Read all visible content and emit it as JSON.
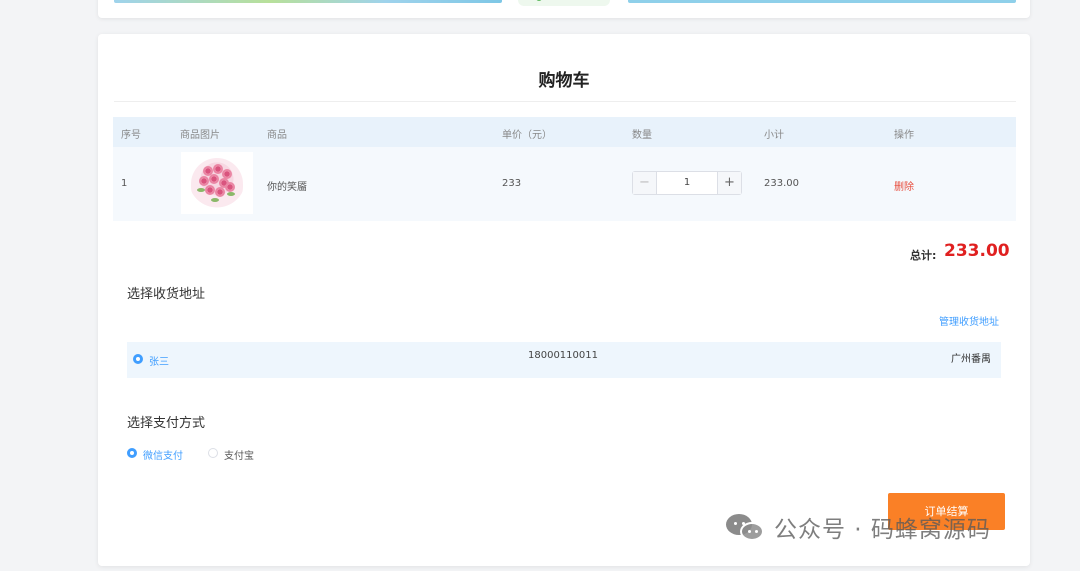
{
  "cart": {
    "title": "购物车",
    "headers": {
      "index": "序号",
      "image": "商品图片",
      "product": "商品",
      "unit_price": "单价（元）",
      "quantity": "数量",
      "subtotal": "小计",
      "action": "操作"
    },
    "items": [
      {
        "index": "1",
        "name": "你的笑靥",
        "unit_price": "233",
        "quantity": "1",
        "subtotal": "233.00",
        "delete_label": "删除"
      }
    ],
    "stepper": {
      "minus": "−",
      "plus": "+"
    },
    "total_label": "总计:",
    "total_value": "233.00"
  },
  "address": {
    "title": "选择收货地址",
    "manage_label": "管理收货地址",
    "entries": [
      {
        "name": "张三",
        "phone": "18000110011",
        "city": "广州番禺",
        "selected": true
      }
    ]
  },
  "payment": {
    "title": "选择支付方式",
    "options": [
      {
        "label": "微信支付",
        "selected": true
      },
      {
        "label": "支付宝",
        "selected": false
      }
    ]
  },
  "checkout_label": "订单结算",
  "watermark": {
    "text": "公众号 · 码蜂窝源码",
    "icon": "wechat-icon"
  },
  "colors": {
    "accent": "#409eff",
    "price": "#e02020",
    "checkout": "#fa8026",
    "delete": "#e74c3c"
  }
}
